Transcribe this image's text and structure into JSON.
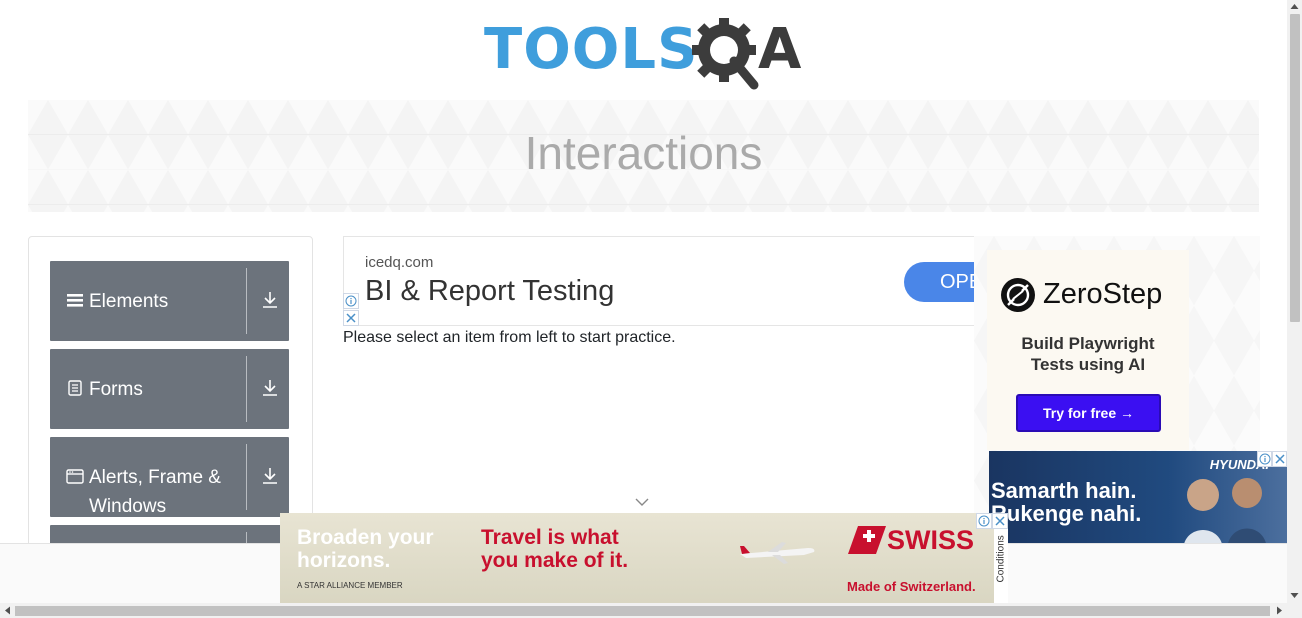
{
  "header": {
    "logo_text_left": "TOOLS",
    "logo_text_right": "A",
    "logo_icon": "gear-magnifier-icon"
  },
  "banner": {
    "title": "Interactions"
  },
  "sidebar": {
    "groups": [
      {
        "label": "Elements",
        "icon": "hamburger-icon"
      },
      {
        "label": "Forms",
        "icon": "document-icon"
      },
      {
        "label": "Alerts, Frame & Windows",
        "icon": "browser-window-icon"
      }
    ]
  },
  "main": {
    "ad": {
      "domain": "icedq.com",
      "headline": "BI & Report Testing",
      "cta": "OPEN"
    },
    "instruction": "Please select an item from left to start practice."
  },
  "right_ads": {
    "zerostep": {
      "brand": "ZeroStep",
      "line1": "Build Playwright",
      "line2": "Tests using AI",
      "cta": "Try for free →"
    },
    "hyundai": {
      "brand": "HYUNDAI",
      "line1": "Samarth hain.",
      "line2": "Rukenge nahi."
    }
  },
  "bottom_ad": {
    "left_line1": "Broaden your",
    "left_line2": "horizons.",
    "alliance": "A STAR ALLIANCE MEMBER",
    "mid_line1": "Travel is what",
    "mid_line2": "you make of it.",
    "brand": "SWISS",
    "tagline": "Made of Switzerland.",
    "side_text": "Conditions"
  },
  "colors": {
    "accent_blue": "#3f9edc",
    "sidebar_gray": "#6c737c",
    "swiss_red": "#c8102e",
    "zerostep_purple": "#3b0ff2"
  }
}
